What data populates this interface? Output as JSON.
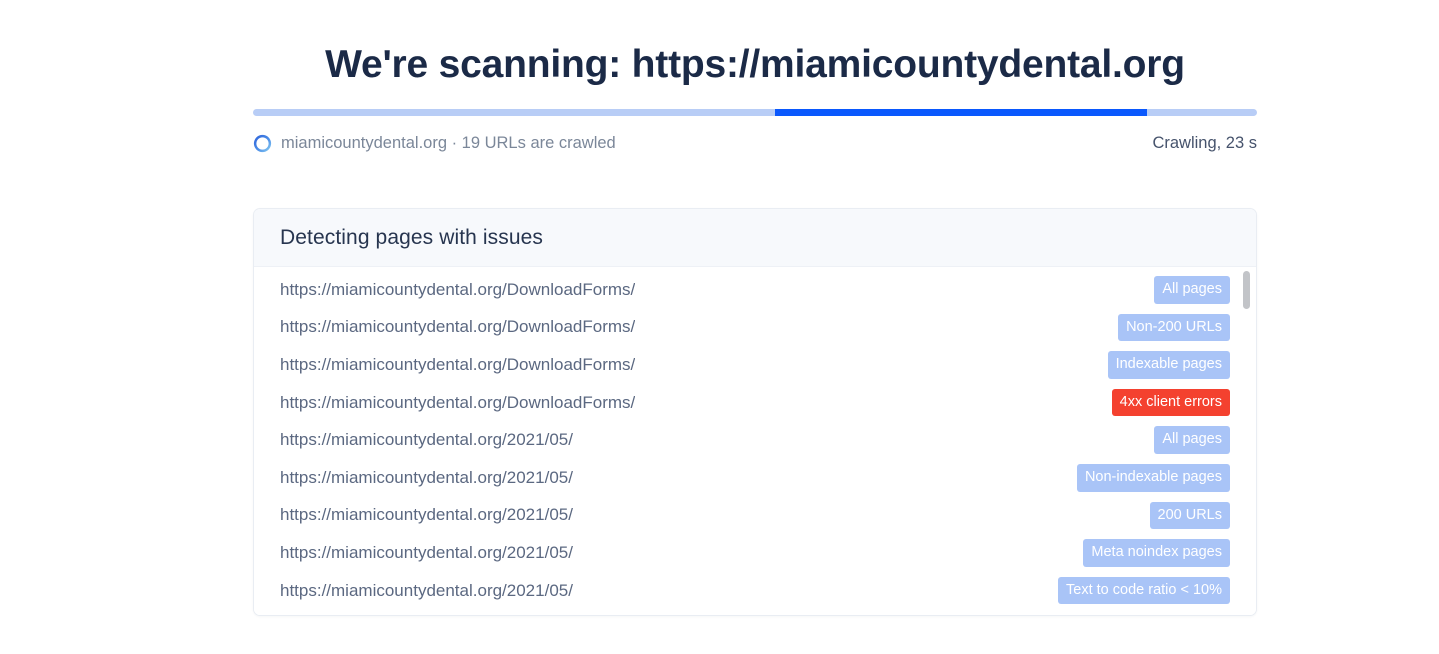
{
  "header": {
    "title": "We're scanning: https://miamicountydental.org"
  },
  "progress": {
    "fill_start_percent": 52,
    "fill_width_percent": 37,
    "track_color": "#b8cdf6",
    "fill_color": "#0a58fd"
  },
  "status": {
    "favicon_name": "site-favicon-tooth",
    "domain_and_count": "miamicountydental.org · 19 URLs are crawled",
    "timer": "Crawling, 23 s"
  },
  "card": {
    "title": "Detecting pages with issues",
    "rows": [
      {
        "url": "https://miamicountydental.org/DownloadForms/",
        "badge": "All pages",
        "tone": "blue"
      },
      {
        "url": "https://miamicountydental.org/DownloadForms/",
        "badge": "Non-200 URLs",
        "tone": "blue"
      },
      {
        "url": "https://miamicountydental.org/DownloadForms/",
        "badge": "Indexable pages",
        "tone": "blue"
      },
      {
        "url": "https://miamicountydental.org/DownloadForms/",
        "badge": "4xx client errors",
        "tone": "red"
      },
      {
        "url": "https://miamicountydental.org/2021/05/",
        "badge": "All pages",
        "tone": "blue"
      },
      {
        "url": "https://miamicountydental.org/2021/05/",
        "badge": "Non-indexable pages",
        "tone": "blue"
      },
      {
        "url": "https://miamicountydental.org/2021/05/",
        "badge": "200 URLs",
        "tone": "blue"
      },
      {
        "url": "https://miamicountydental.org/2021/05/",
        "badge": "Meta noindex pages",
        "tone": "blue"
      },
      {
        "url": "https://miamicountydental.org/2021/05/",
        "badge": "Text to code ratio < 10%",
        "tone": "blue"
      }
    ]
  },
  "colors": {
    "badge_blue": "#a9c4f7",
    "badge_red": "#f4412f",
    "title_text": "#1b2a47",
    "url_text": "#5b6881"
  }
}
